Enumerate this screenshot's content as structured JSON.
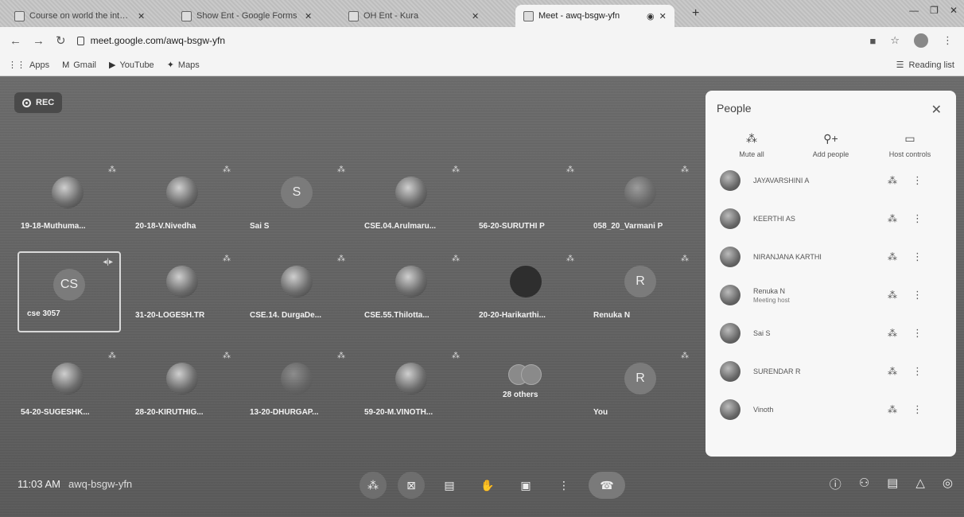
{
  "browser": {
    "tabs": [
      {
        "title": "Course on world the internet"
      },
      {
        "title": "Show Ent - Google Forms"
      },
      {
        "title": "OH Ent - Kura"
      },
      {
        "title": "Meet - awq-bsgw-yfn",
        "active": true
      }
    ],
    "url": "meet.google.com/awq-bsgw-yfn",
    "bookmarks": [
      "Apps",
      "Gmail",
      "YouTube",
      "Maps"
    ],
    "reading_list": "Reading list"
  },
  "meet": {
    "rec_label": "REC",
    "tiles_row1": [
      {
        "name": "19-18-Muthuma...",
        "type": "photo"
      },
      {
        "name": "20-18-V.Nivedha",
        "type": "photo"
      },
      {
        "name": "Sai S",
        "type": "initial",
        "initial": "S"
      },
      {
        "name": "CSE.04.Arulmaru...",
        "type": "photo"
      },
      {
        "name": "56-20-SURUTHI P",
        "type": "blank"
      },
      {
        "name": "058_20_Varmani P",
        "type": "photo"
      }
    ],
    "tiles_row2": [
      {
        "name": "cse 3057",
        "type": "initial",
        "initial": "CS",
        "selected": true
      },
      {
        "name": "31-20-LOGESH.TR",
        "type": "photo"
      },
      {
        "name": "CSE.14. DurgaDe...",
        "type": "photo"
      },
      {
        "name": "CSE.55.Thilotta...",
        "type": "photo"
      },
      {
        "name": "20-20-Harikarthi...",
        "type": "photo"
      },
      {
        "name": "Renuka N",
        "type": "initial",
        "initial": "R"
      }
    ],
    "tiles_row3": [
      {
        "name": "54-20-SUGESHK...",
        "type": "photo"
      },
      {
        "name": "28-20-KIRUTHIG...",
        "type": "photo"
      },
      {
        "name": "13-20-DHURGAP...",
        "type": "photo"
      },
      {
        "name": "59-20-M.VINOTH...",
        "type": "photo"
      },
      {
        "name": "28 others",
        "type": "others"
      },
      {
        "name": "You",
        "type": "initial",
        "initial": "R"
      }
    ],
    "time": "11:03 AM",
    "meeting_code": "awq-bsgw-yfn"
  },
  "people_panel": {
    "title": "People",
    "actions": [
      "Mute all",
      "Add people",
      "Host controls"
    ],
    "participants": [
      {
        "name": "JAYAVARSHINI A",
        "sub": ""
      },
      {
        "name": "KEERTHI AS",
        "sub": ""
      },
      {
        "name": "NIRANJANA KARTHI",
        "sub": ""
      },
      {
        "name": "Renuka N",
        "sub": "Meeting host"
      },
      {
        "name": "Sai S",
        "sub": ""
      },
      {
        "name": "SURENDAR R",
        "sub": ""
      },
      {
        "name": "Vinoth",
        "sub": ""
      }
    ]
  }
}
